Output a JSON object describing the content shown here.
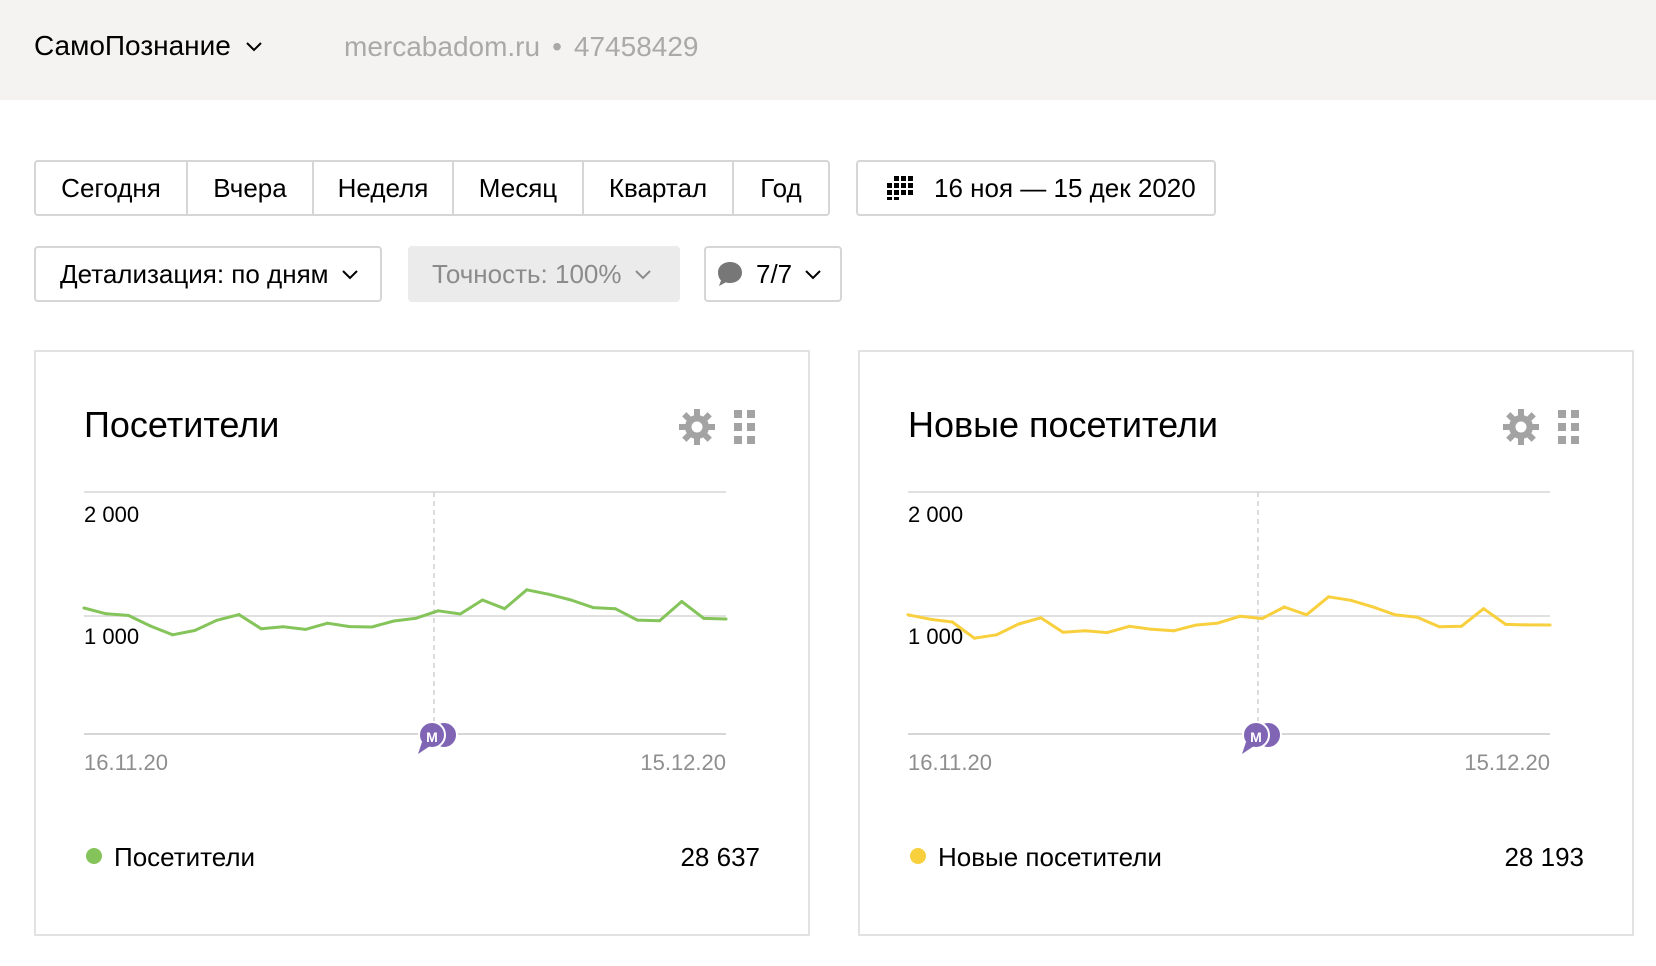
{
  "header": {
    "site_name": "СамоПознание",
    "domain": "mercabadom.ru",
    "separator": "•",
    "counter_id": "47458429"
  },
  "periods": [
    "Сегодня",
    "Вчера",
    "Неделя",
    "Месяц",
    "Квартал",
    "Год"
  ],
  "date_range": "16 ноя — 15 дек 2020",
  "filters": {
    "detail": "Детализация: по дням",
    "accuracy": "Точность: 100%",
    "notes": "7/7"
  },
  "colors": {
    "visitors": "#85c45a",
    "new_visitors": "#f8cf3d",
    "note_marker": "#8065b5",
    "grid": "#e0e0e0"
  },
  "cards": [
    {
      "title": "Посетители",
      "legend_label": "Посетители",
      "total": "28 637",
      "color": "#85c45a",
      "x_start": "16.11.20",
      "x_end": "15.12.20",
      "y_ticks": [
        "2 000",
        "1 000"
      ],
      "note_marker": "М"
    },
    {
      "title": "Новые посетители",
      "legend_label": "Новые посетители",
      "total": "28 193",
      "color": "#f8cf3d",
      "x_start": "16.11.20",
      "x_end": "15.12.20",
      "y_ticks": [
        "2 000",
        "1 000"
      ],
      "note_marker": "М"
    }
  ],
  "chart_data": [
    {
      "type": "line",
      "title": "Посетители",
      "x": [
        "16.11.20",
        "15.12.20"
      ],
      "series": [
        {
          "name": "Посетители",
          "values": [
            1067,
            1018,
            1005,
            917,
            843,
            879,
            964,
            1012,
            894,
            910,
            888,
            940,
            912,
            908,
            958,
            982,
            1043,
            1017,
            1133,
            1061,
            1218,
            1181,
            1133,
            1070,
            1061,
            966,
            961,
            1121,
            980,
            975
          ]
        }
      ],
      "ylim": [
        0,
        2000
      ],
      "y_ticks": [
        1000,
        2000
      ],
      "grid": true,
      "legend": "bottom-left"
    },
    {
      "type": "line",
      "title": "Новые посетители",
      "x": [
        "16.11.20",
        "15.12.20"
      ],
      "series": [
        {
          "name": "Новые посетители",
          "values": [
            1010,
            973,
            950,
            815,
            843,
            933,
            985,
            865,
            877,
            862,
            914,
            889,
            877,
            924,
            941,
            998,
            979,
            1075,
            1010,
            1160,
            1131,
            1076,
            1010,
            990,
            910,
            914,
            1061,
            930,
            926,
            925
          ]
        }
      ],
      "ylim": [
        0,
        2000
      ],
      "y_ticks": [
        1000,
        2000
      ],
      "grid": true,
      "legend": "bottom-left"
    }
  ]
}
